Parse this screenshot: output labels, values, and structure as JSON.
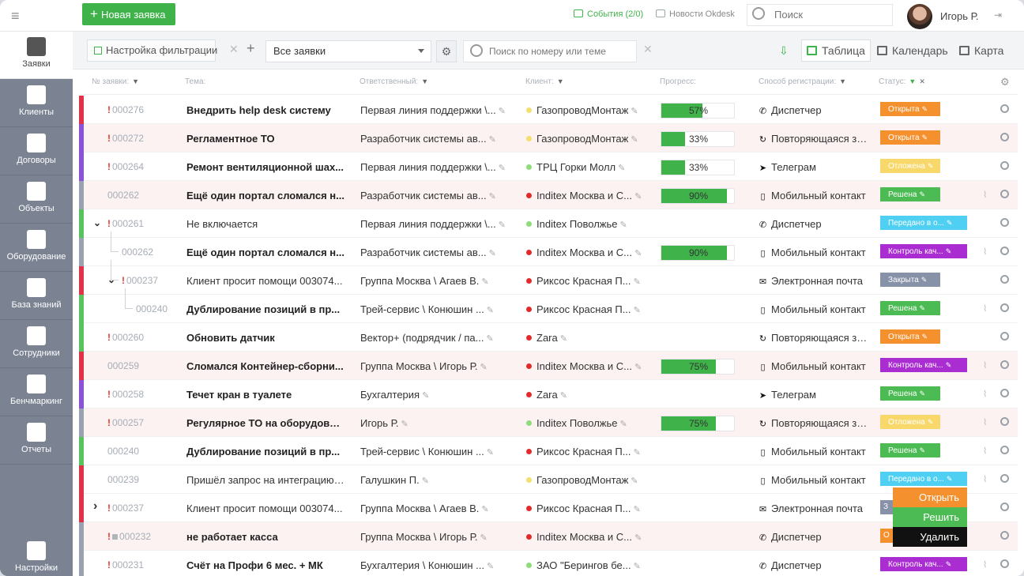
{
  "topbar": {
    "new_request": "Новая заявка",
    "events_label": "События",
    "events_count": "(2/0)",
    "news_label": "Новости Okdesk",
    "search_placeholder": "Поиск",
    "user_name": "Игорь Р."
  },
  "sidebar": {
    "items": [
      {
        "label": "Заявки",
        "icon": "bell-icon",
        "active": true
      },
      {
        "label": "Клиенты",
        "icon": "briefcase-icon"
      },
      {
        "label": "Договоры",
        "icon": "documents-icon"
      },
      {
        "label": "Объекты",
        "icon": "building-icon"
      },
      {
        "label": "Оборудование",
        "icon": "server-icon"
      },
      {
        "label": "База знаний",
        "icon": "book-icon"
      },
      {
        "label": "Сотрудники",
        "icon": "person-icon"
      },
      {
        "label": "Бенчмаркинг",
        "icon": "gauge-icon"
      },
      {
        "label": "Отчеты",
        "icon": "bar-chart-icon"
      },
      {
        "label": "Настройки",
        "icon": "gear-icon"
      }
    ]
  },
  "toolbar": {
    "filter_settings": "Настройка фильтрации",
    "select_value": "Все заявки",
    "search_placeholder": "Поиск по номеру или теме",
    "view_table": "Таблица",
    "view_calendar": "Календарь",
    "view_map": "Карта"
  },
  "columns": {
    "number": "№ заявки:",
    "theme": "Тема:",
    "responsible": "Ответственный:",
    "client": "Клиент:",
    "progress": "Прогресс:",
    "registration": "Способ регистрации:",
    "status": "Статус:"
  },
  "colors": {
    "accent": "#3fb24a",
    "bar_red": "#e0334a",
    "bar_purple": "#8a52d6",
    "bar_green": "#58c25f",
    "bar_gray": "#9aa2b0",
    "status_open": "#f5902f",
    "status_wait": "#f8d86a",
    "status_solved": "#4cbb54",
    "status_passed": "#4fd0f2",
    "status_control": "#a92dd1",
    "status_closed": "#8791a8"
  },
  "rows": [
    {
      "bar": "red",
      "pink": false,
      "urgent": true,
      "number": "000276",
      "theme": "Внедрить help desk систему",
      "bold": true,
      "responsible": "Первая линия поддержки \\...",
      "client": "ГазопроводМонтаж",
      "dot": "#f3df6e",
      "progress": "57%",
      "progress_value": 57,
      "reg": "Диспетчер",
      "reg_icon": "phone-icon",
      "status": "Открыта",
      "status_color": "#f5902f",
      "clip": false
    },
    {
      "bar": "purple",
      "pink": true,
      "urgent": true,
      "number": "000272",
      "theme": "Регламентное ТО",
      "bold": true,
      "responsible": "Разработчик системы ав...",
      "client": "ГазопроводМонтаж",
      "dot": "#f3df6e",
      "progress": "33%",
      "progress_value": 33,
      "reg": "Повторяющаяся за...",
      "reg_icon": "repeat-icon",
      "status": "Открыта",
      "status_color": "#f5902f",
      "clip": false
    },
    {
      "bar": "purple",
      "pink": false,
      "urgent": true,
      "number": "000264",
      "theme": "Ремонт вентиляционной шах...",
      "bold": true,
      "responsible": "Первая линия поддержки \\...",
      "client": "ТРЦ Горки Молл",
      "dot": "#8fdc7a",
      "progress": "33%",
      "progress_value": 33,
      "reg": "Телеграм",
      "reg_icon": "telegram-icon",
      "status": "Отложена",
      "status_color": "#f8d86a",
      "clip": false
    },
    {
      "bar": "gray",
      "pink": true,
      "urgent": false,
      "number": "000262",
      "theme": "Ещё один портал сломался н...",
      "bold": true,
      "responsible": "Разработчик системы ав...",
      "client": "Inditex Москва и С...",
      "dot": "#e22a2a",
      "progress": "90%",
      "progress_value": 90,
      "reg": "Мобильный контакт",
      "reg_icon": "mobile-icon",
      "status": "Решена",
      "status_color": "#4cbb54",
      "clip": true
    },
    {
      "bar": "green",
      "pink": false,
      "urgent": true,
      "number": "000261",
      "theme": "Не включается",
      "bold": false,
      "responsible": "Первая линия поддержки \\...",
      "client": "Inditex Поволжье",
      "dot": "#8fdc7a",
      "progress": "",
      "progress_value": null,
      "reg": "Диспетчер",
      "reg_icon": "phone-icon",
      "status": "Передано в о...",
      "status_color": "#4fd0f2",
      "clip": false,
      "chev": "down"
    },
    {
      "bar": "gray",
      "pink": false,
      "urgent": false,
      "number": "000262",
      "theme": "Ещё один портал сломался н...",
      "bold": true,
      "responsible": "Разработчик системы ав...",
      "client": "Inditex Москва и С...",
      "dot": "#e22a2a",
      "progress": "90%",
      "progress_value": 90,
      "reg": "Мобильный контакт",
      "reg_icon": "mobile-icon",
      "status": "Контроль кач...",
      "status_color": "#a92dd1",
      "clip": true,
      "indent": 1
    },
    {
      "bar": "red",
      "pink": false,
      "urgent": true,
      "number": "000237",
      "theme": "Клиент просит помощи 003074...",
      "bold": false,
      "responsible": "Группа Москва \\ Агаев В.",
      "client": "Риксос Красная П...",
      "dot": "#e22a2a",
      "progress": "",
      "progress_value": null,
      "reg": "Электронная почта",
      "reg_icon": "mail-icon",
      "status": "Закрыта",
      "status_color": "#8791a8",
      "clip": false,
      "indent": 1,
      "chev": "down"
    },
    {
      "bar": "green",
      "pink": false,
      "urgent": false,
      "number": "000240",
      "theme": "Дублирование позиций в пр...",
      "bold": true,
      "responsible": "Трей-сервис \\ Конюшин ...",
      "client": "Риксос Красная П...",
      "dot": "#e22a2a",
      "progress": "",
      "progress_value": null,
      "reg": "Мобильный контакт",
      "reg_icon": "mobile-icon",
      "status": "Решена",
      "status_color": "#4cbb54",
      "clip": true,
      "indent": 2
    },
    {
      "bar": "green",
      "pink": false,
      "urgent": true,
      "number": "000260",
      "theme": "Обновить датчик",
      "bold": true,
      "responsible": "Вектор+ (подрядчик / па...",
      "client": "Zara",
      "dot": "#e22a2a",
      "progress": "",
      "progress_value": null,
      "reg": "Повторяющаяся за...",
      "reg_icon": "repeat-icon",
      "status": "Открыта",
      "status_color": "#f5902f",
      "clip": false
    },
    {
      "bar": "red",
      "pink": true,
      "urgent": false,
      "number": "000259",
      "theme": "Сломался Контейнер-сборни...",
      "bold": true,
      "responsible": "Группа Москва \\ Игорь Р.",
      "client": "Inditex Москва и С...",
      "dot": "#e22a2a",
      "progress": "75%",
      "progress_value": 75,
      "reg": "Мобильный контакт",
      "reg_icon": "mobile-icon",
      "status": "Контроль кач...",
      "status_color": "#a92dd1",
      "clip": true
    },
    {
      "bar": "purple",
      "pink": false,
      "urgent": true,
      "number": "000258",
      "theme": "Течет кран в туалете",
      "bold": true,
      "responsible": "Бухгалтерия",
      "client": "Zara",
      "dot": "#e22a2a",
      "progress": "",
      "progress_value": null,
      "reg": "Телеграм",
      "reg_icon": "telegram-icon",
      "status": "Решена",
      "status_color": "#4cbb54",
      "clip": true
    },
    {
      "bar": "gray",
      "pink": true,
      "urgent": true,
      "number": "000257",
      "theme": "Регулярное ТО на оборудован...",
      "bold": true,
      "responsible": "Игорь Р.",
      "client": "Inditex Поволжье",
      "dot": "#8fdc7a",
      "progress": "75%",
      "progress_value": 75,
      "reg": "Повторяющаяся за...",
      "reg_icon": "repeat-icon",
      "status": "Отложена",
      "status_color": "#f8d86a",
      "clip": true
    },
    {
      "bar": "green",
      "pink": false,
      "urgent": false,
      "number": "000240",
      "theme": "Дублирование позиций в пр...",
      "bold": true,
      "responsible": "Трей-сервис \\ Конюшин ...",
      "client": "Риксос Красная П...",
      "dot": "#e22a2a",
      "progress": "",
      "progress_value": null,
      "reg": "Мобильный контакт",
      "reg_icon": "mobile-icon",
      "status": "Решена",
      "status_color": "#4cbb54",
      "clip": true
    },
    {
      "bar": "red",
      "pink": false,
      "urgent": false,
      "number": "000239",
      "theme": "Пришёл запрос на интеграцию ...",
      "bold": false,
      "responsible": "Галушкин П.",
      "client": "ГазопроводМонтаж",
      "dot": "#f3df6e",
      "progress": "",
      "progress_value": null,
      "reg": "Мобильный контакт",
      "reg_icon": "mobile-icon",
      "status": "Передано в о...",
      "status_color": "#4fd0f2",
      "clip": true
    },
    {
      "bar": "red",
      "pink": false,
      "urgent": true,
      "number": "000237",
      "theme": "Клиент просит помощи 003074...",
      "bold": false,
      "responsible": "Группа Москва \\ Агаев В.",
      "client": "Риксос Красная П...",
      "dot": "#e22a2a",
      "progress": "",
      "progress_value": null,
      "reg": "Электронная почта",
      "reg_icon": "mail-icon",
      "status": "З",
      "status_color": "#8791a8",
      "clip": false,
      "chev": "right"
    },
    {
      "bar": "gray",
      "pink": true,
      "urgent": true,
      "locked": true,
      "number": "000232",
      "theme": "не работает касса",
      "bold": true,
      "responsible": "Группа Москва \\ Игорь Р.",
      "client": "Inditex Москва и С...",
      "dot": "#e22a2a",
      "progress": "",
      "progress_value": null,
      "reg": "Диспетчер",
      "reg_icon": "phone-icon",
      "status": "О",
      "status_color": "#f5902f",
      "clip": false
    },
    {
      "bar": "gray",
      "pink": false,
      "urgent": true,
      "number": "000231",
      "theme": "Счёт на Профи 6 мес. + МК",
      "bold": true,
      "responsible": "Бухгалтерия \\ Конюшин ...",
      "client": "ЗАО \"Берингов бе...",
      "dot": "#8fdc7a",
      "progress": "",
      "progress_value": null,
      "reg": "Диспетчер",
      "reg_icon": "phone-icon",
      "status": "Контроль кач...",
      "status_color": "#a92dd1",
      "clip": true
    }
  ],
  "context_menu": [
    {
      "label": "Открыть",
      "color": "#f5902f"
    },
    {
      "label": "Решить",
      "color": "#4cbb54"
    },
    {
      "label": "Удалить",
      "color": "#111111"
    }
  ]
}
